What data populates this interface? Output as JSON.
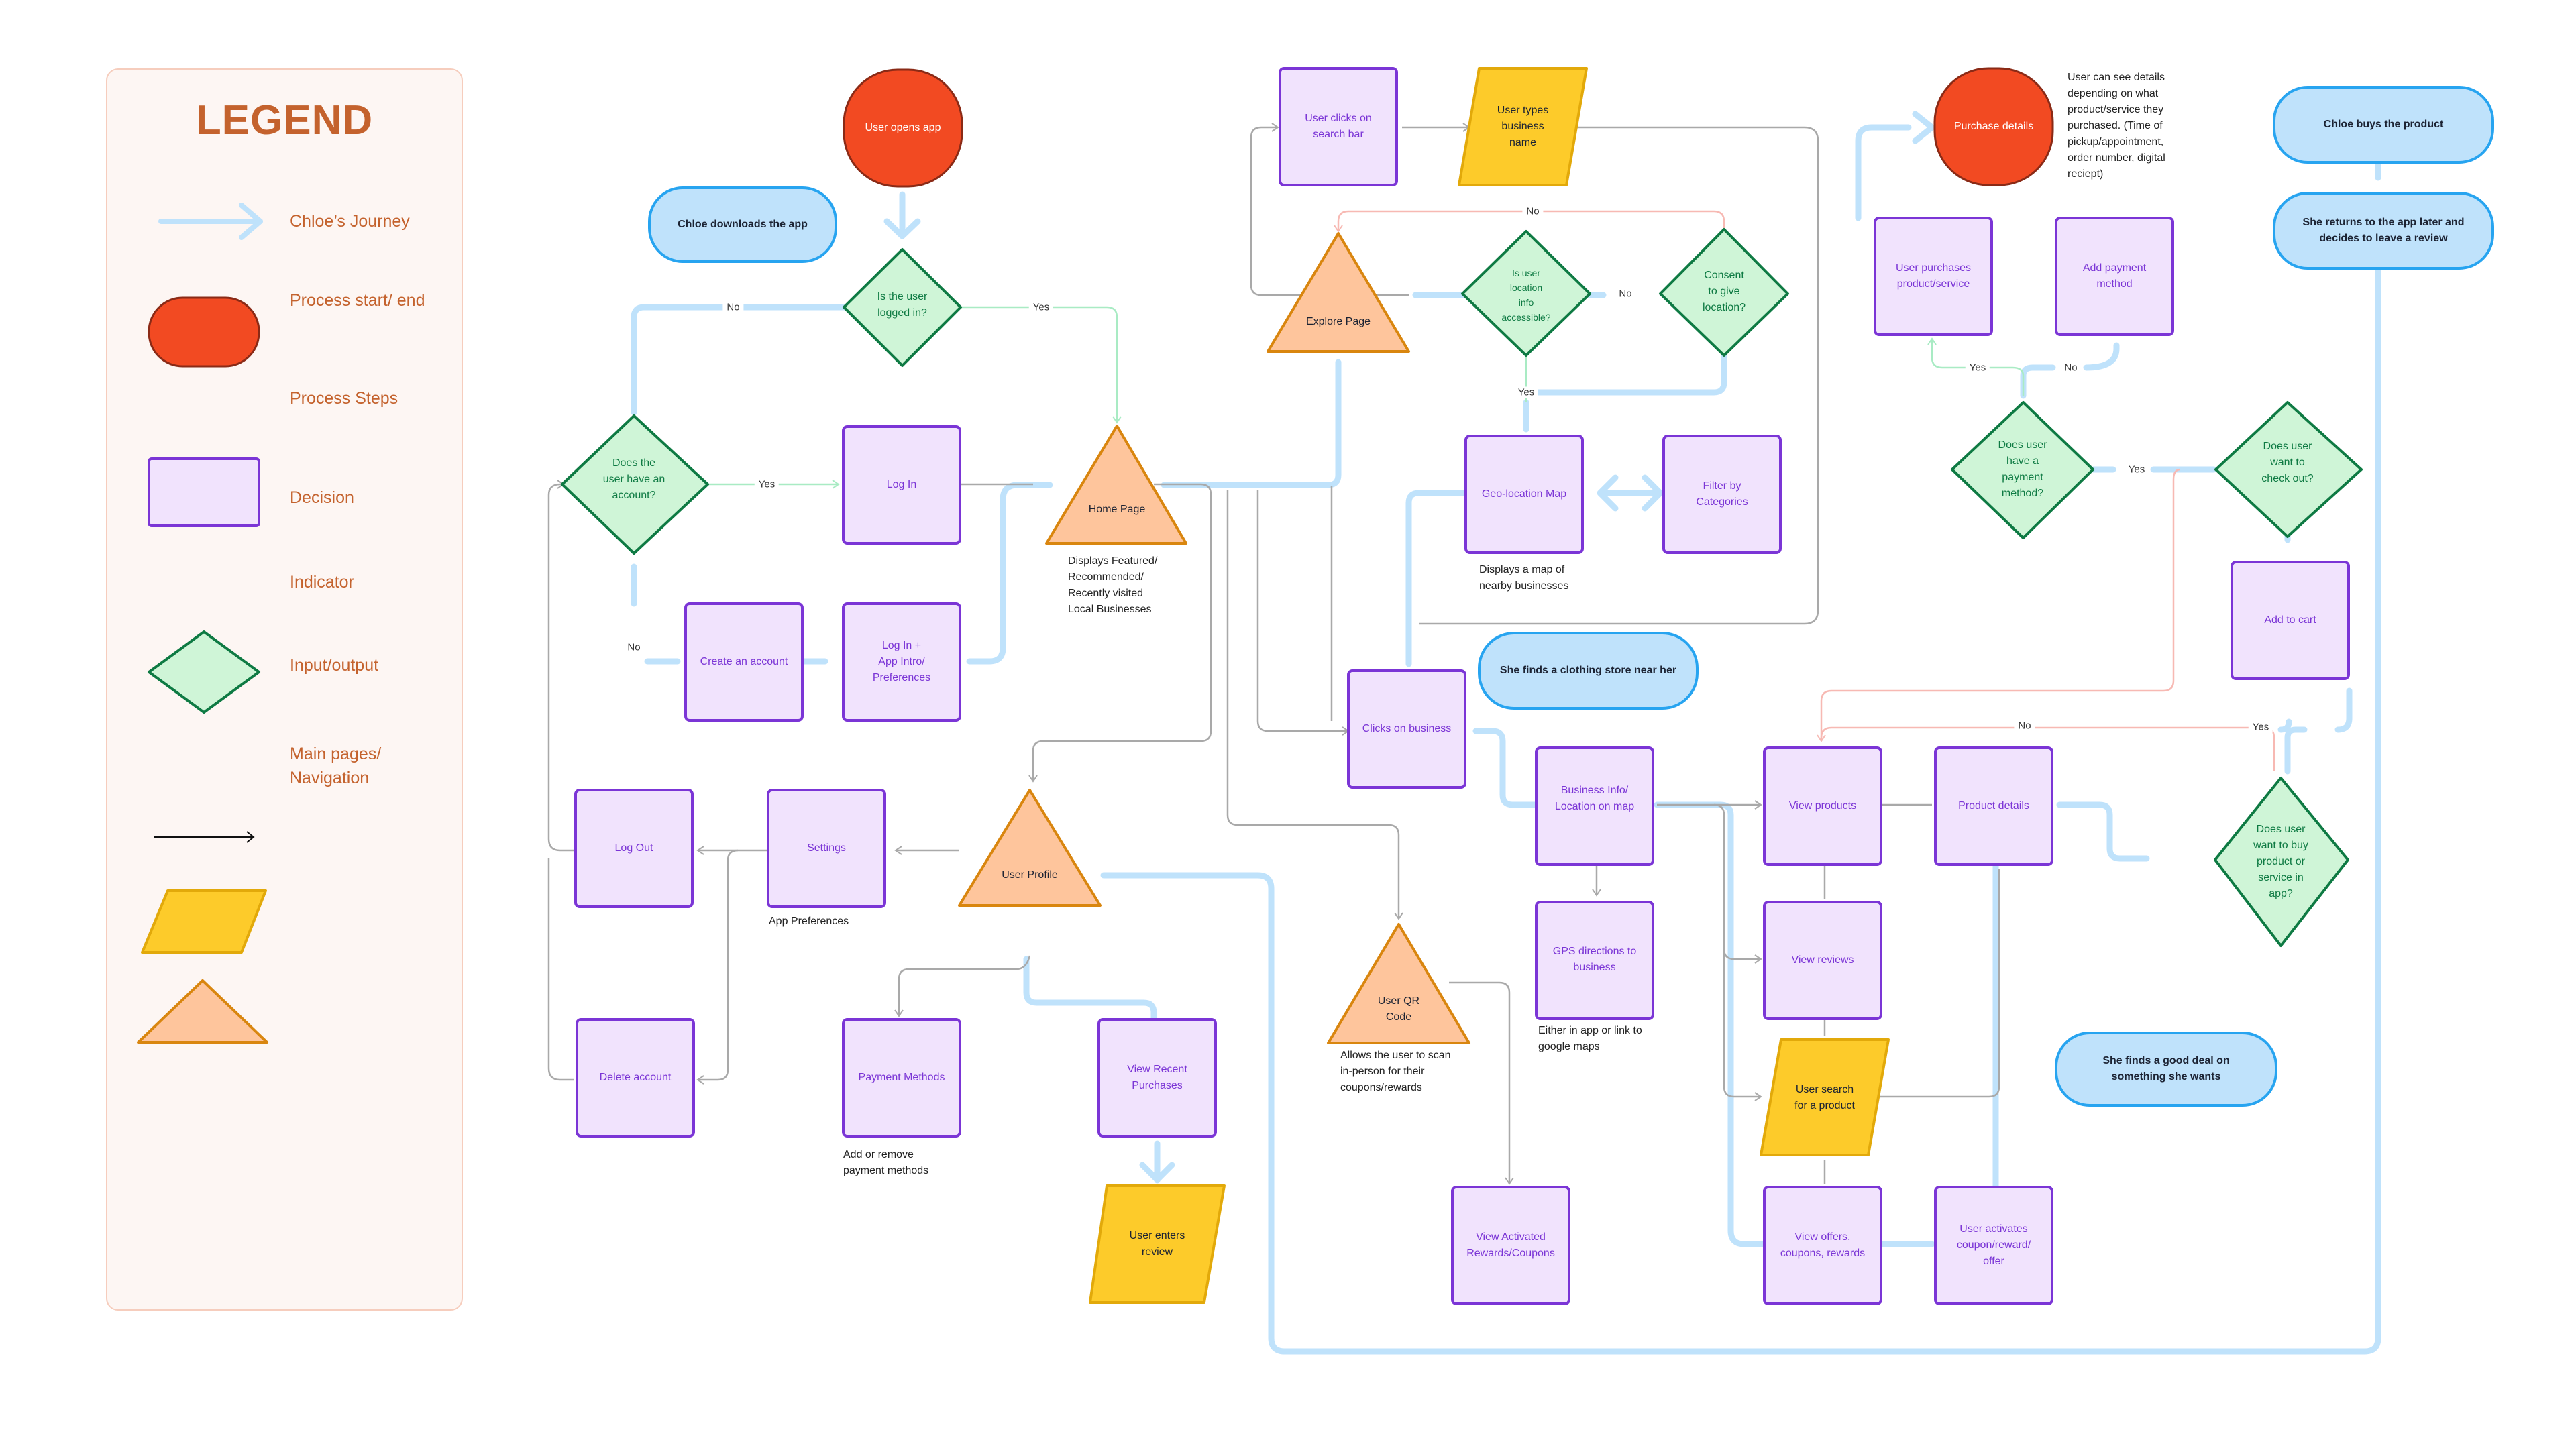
{
  "colors": {
    "journey": "#bfe2fb",
    "terminal_fill": "#f24a22",
    "terminal_stroke": "#8a2a16",
    "process_fill": "#f1e3fd",
    "process_stroke": "#7b35d6",
    "process_text": "#7b35d6",
    "decision_fill": "#cff5d7",
    "decision_stroke": "#0e7a43",
    "decision_text": "#0e7a43",
    "io_fill": "#fdcb2a",
    "io_stroke": "#e2a90a",
    "nav_fill": "#fec59c",
    "nav_stroke": "#d9860f",
    "story_fill": "#bfe2fb",
    "story_stroke": "#27a4f0",
    "indicator": "#a9a9a9",
    "no_path": "#f7b9b3",
    "yes_path": "#a9ebc4",
    "legend_text": "#c4622d"
  },
  "legend": {
    "title": "LEGEND",
    "items": [
      {
        "label": "Chloe’s Journey",
        "icon": "journey-arrow-icon"
      },
      {
        "label": "Process start/ end",
        "icon": "terminal-shape-icon"
      },
      {
        "label": "Process Steps",
        "icon": "process-shape-icon"
      },
      {
        "label": "Decision",
        "icon": "decision-shape-icon"
      },
      {
        "label": "Indicator",
        "icon": "indicator-arrow-icon"
      },
      {
        "label": "Input/output",
        "icon": "io-shape-icon"
      },
      {
        "label": "Main pages/\nNavigation",
        "icon": "nav-shape-icon"
      }
    ]
  },
  "nodes": {
    "user_opens_app": "User opens app",
    "chloe_downloads": "Chloe downloads the app",
    "is_logged_in": "Is the user\nlogged in?",
    "has_account": "Does the\nuser have an\naccount?",
    "log_in": "Log In",
    "create_account": "Create an account",
    "login_intro": "Log In +\nApp Intro/\nPreferences",
    "home_page": "Home Page",
    "explore_page": "Explore Page",
    "search_bar": "User clicks on\nsearch bar",
    "types_business": "User types\nbusiness\nname",
    "location_accessible": "Is user\nlocation\ninfo\naccessible?",
    "consent_location": "Consent\nto give\nlocation?",
    "geo_map": "Geo-location Map",
    "filter_categories": "Filter by\nCategories",
    "finds_store": "She finds a clothing store near her",
    "clicks_business": "Clicks on business",
    "business_info": "Business Info/\nLocation on map",
    "gps_directions": "GPS directions to\nbusiness",
    "view_products": "View products",
    "product_details": "Product details",
    "view_reviews": "View reviews",
    "user_search_product": "User search\nfor a product",
    "view_offers": "View offers,\ncoupons, rewards",
    "activates_coupon": "User activates\ncoupon/reward/\noffer",
    "finds_deal": "She finds a good deal on\nsomething she wants",
    "want_to_buy": "Does user\nwant to buy\nproduct or\nservice in\napp?",
    "add_to_cart": "Add to cart",
    "want_checkout": "Does user\nwant to\ncheck out?",
    "has_payment": "Does user\nhave a\npayment\nmethod?",
    "purchases": "User purchases\nproduct/service",
    "add_payment": "Add payment\nmethod",
    "purchase_details": "Purchase details",
    "chloe_buys": "Chloe buys the product",
    "returns_review": "She returns to the app later and\ndecides to leave a review",
    "user_profile": "User Profile",
    "settings": "Settings",
    "log_out": "Log Out",
    "delete_account": "Delete account",
    "payment_methods": "Payment Methods",
    "view_recent": "View Recent\nPurchases",
    "enters_review": "User enters\nreview",
    "qr_code": "User QR\nCode",
    "view_activated": "View Activated\nRewards/Coupons"
  },
  "notes": {
    "home_page": "Displays Featured/\nRecommended/\nRecently visited\nLocal Businesses",
    "geo_map": "Displays a map of\nnearby businesses",
    "purchase_details": "User can see details\ndepending on what\nproduct/service they\npurchased. (Time of\npickup/appointment,\norder number, digital\nreciept)",
    "settings": "App Preferences",
    "payment_methods": "Add or remove\npayment methods",
    "qr_code": "Allows the user to scan\nin-person for their\ncoupons/rewards",
    "gps": "Either in app or link to\ngoogle maps"
  },
  "edge_labels": {
    "no": "No",
    "yes": "Yes"
  }
}
